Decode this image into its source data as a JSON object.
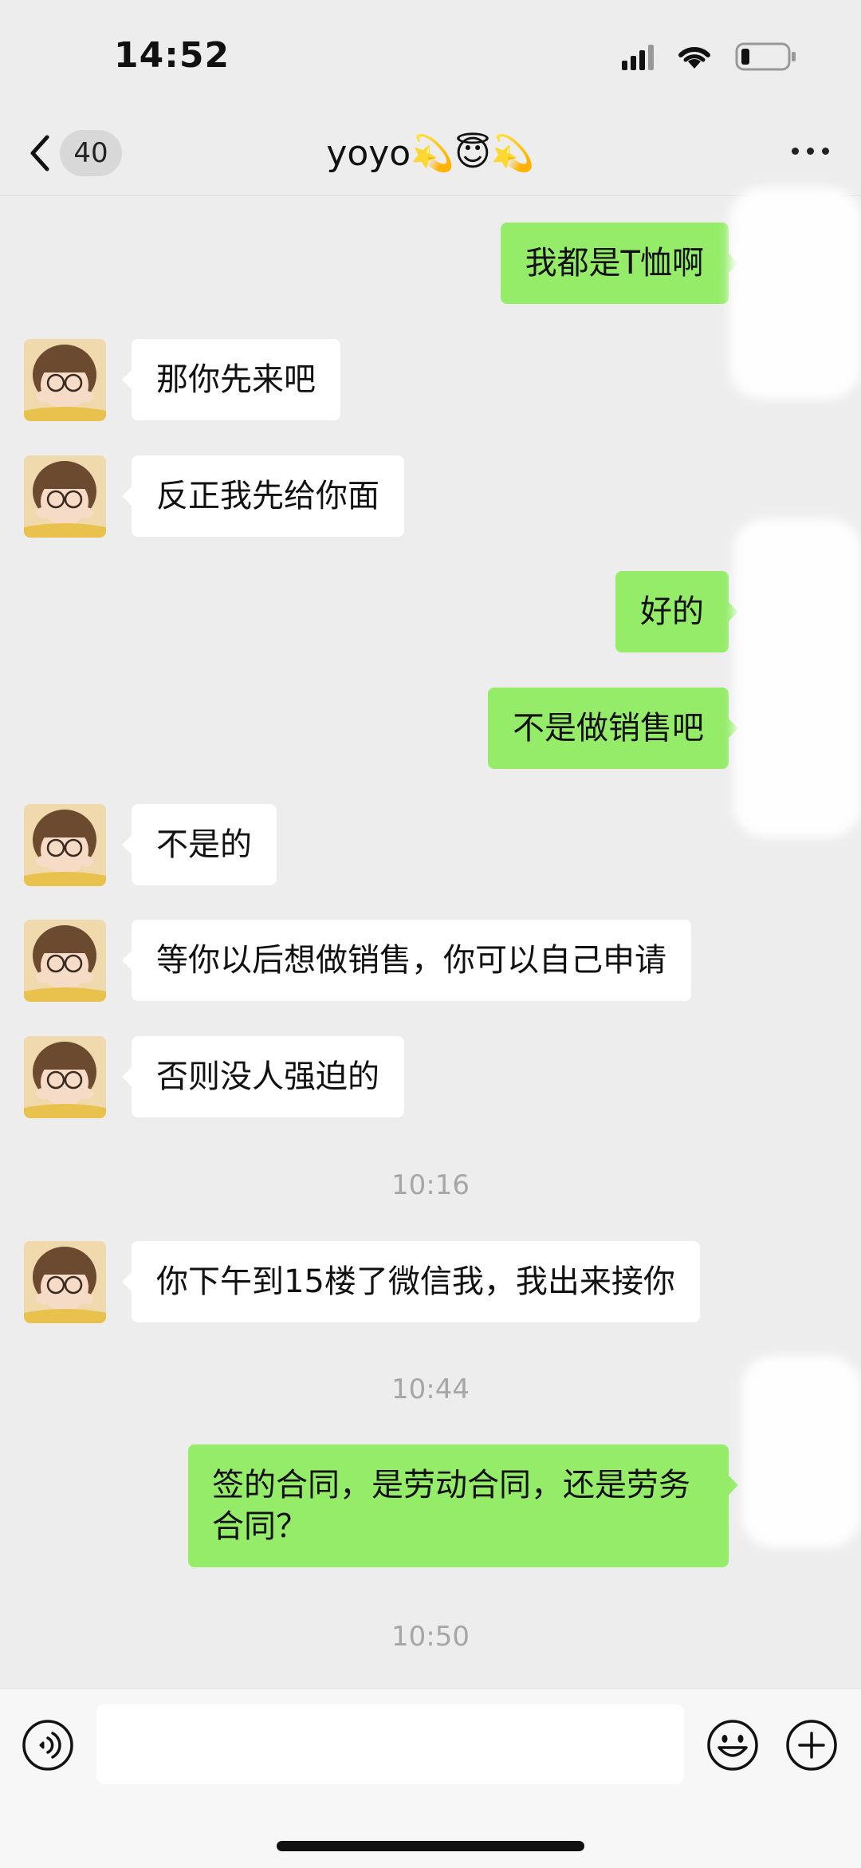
{
  "status_bar": {
    "time": "14:52"
  },
  "header": {
    "back_badge": "40",
    "title": "yoyo💫😇💫"
  },
  "messages": [
    {
      "side": "right",
      "text": "我都是T恤啊"
    },
    {
      "side": "left",
      "text": "那你先来吧"
    },
    {
      "side": "left",
      "text": "反正我先给你面"
    },
    {
      "side": "right",
      "text": "好的"
    },
    {
      "side": "right",
      "text": "不是做销售吧"
    },
    {
      "side": "left",
      "text": "不是的"
    },
    {
      "side": "left",
      "text": "等你以后想做销售，你可以自己申请"
    },
    {
      "side": "left",
      "text": "否则没人强迫的"
    },
    {
      "side": "left",
      "text": "你下午到15楼了微信我，我出来接你"
    },
    {
      "side": "right",
      "text": "签的合同，是劳动合同，还是劳务合同？"
    }
  ],
  "timestamps": [
    "10:16",
    "10:44",
    "10:50"
  ],
  "input": {
    "value": ""
  },
  "colors": {
    "background": "#ededed",
    "sent_bubble": "#95ec69",
    "received_bubble": "#ffffff",
    "timestamp": "#a6a6a6"
  },
  "icons": {
    "back": "chevron-left-icon",
    "more": "more-dots-icon",
    "voice": "voice-icon",
    "emoji": "emoji-icon",
    "plus": "plus-icon"
  }
}
